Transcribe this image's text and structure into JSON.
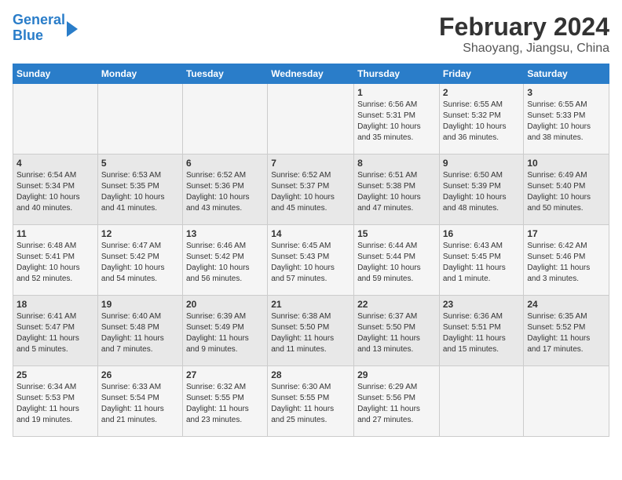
{
  "logo": {
    "line1": "General",
    "line2": "Blue"
  },
  "title": "February 2024",
  "subtitle": "Shaoyang, Jiangsu, China",
  "weekdays": [
    "Sunday",
    "Monday",
    "Tuesday",
    "Wednesday",
    "Thursday",
    "Friday",
    "Saturday"
  ],
  "weeks": [
    [
      {
        "day": "",
        "info": ""
      },
      {
        "day": "",
        "info": ""
      },
      {
        "day": "",
        "info": ""
      },
      {
        "day": "",
        "info": ""
      },
      {
        "day": "1",
        "info": "Sunrise: 6:56 AM\nSunset: 5:31 PM\nDaylight: 10 hours\nand 35 minutes."
      },
      {
        "day": "2",
        "info": "Sunrise: 6:55 AM\nSunset: 5:32 PM\nDaylight: 10 hours\nand 36 minutes."
      },
      {
        "day": "3",
        "info": "Sunrise: 6:55 AM\nSunset: 5:33 PM\nDaylight: 10 hours\nand 38 minutes."
      }
    ],
    [
      {
        "day": "4",
        "info": "Sunrise: 6:54 AM\nSunset: 5:34 PM\nDaylight: 10 hours\nand 40 minutes."
      },
      {
        "day": "5",
        "info": "Sunrise: 6:53 AM\nSunset: 5:35 PM\nDaylight: 10 hours\nand 41 minutes."
      },
      {
        "day": "6",
        "info": "Sunrise: 6:52 AM\nSunset: 5:36 PM\nDaylight: 10 hours\nand 43 minutes."
      },
      {
        "day": "7",
        "info": "Sunrise: 6:52 AM\nSunset: 5:37 PM\nDaylight: 10 hours\nand 45 minutes."
      },
      {
        "day": "8",
        "info": "Sunrise: 6:51 AM\nSunset: 5:38 PM\nDaylight: 10 hours\nand 47 minutes."
      },
      {
        "day": "9",
        "info": "Sunrise: 6:50 AM\nSunset: 5:39 PM\nDaylight: 10 hours\nand 48 minutes."
      },
      {
        "day": "10",
        "info": "Sunrise: 6:49 AM\nSunset: 5:40 PM\nDaylight: 10 hours\nand 50 minutes."
      }
    ],
    [
      {
        "day": "11",
        "info": "Sunrise: 6:48 AM\nSunset: 5:41 PM\nDaylight: 10 hours\nand 52 minutes."
      },
      {
        "day": "12",
        "info": "Sunrise: 6:47 AM\nSunset: 5:42 PM\nDaylight: 10 hours\nand 54 minutes."
      },
      {
        "day": "13",
        "info": "Sunrise: 6:46 AM\nSunset: 5:42 PM\nDaylight: 10 hours\nand 56 minutes."
      },
      {
        "day": "14",
        "info": "Sunrise: 6:45 AM\nSunset: 5:43 PM\nDaylight: 10 hours\nand 57 minutes."
      },
      {
        "day": "15",
        "info": "Sunrise: 6:44 AM\nSunset: 5:44 PM\nDaylight: 10 hours\nand 59 minutes."
      },
      {
        "day": "16",
        "info": "Sunrise: 6:43 AM\nSunset: 5:45 PM\nDaylight: 11 hours\nand 1 minute."
      },
      {
        "day": "17",
        "info": "Sunrise: 6:42 AM\nSunset: 5:46 PM\nDaylight: 11 hours\nand 3 minutes."
      }
    ],
    [
      {
        "day": "18",
        "info": "Sunrise: 6:41 AM\nSunset: 5:47 PM\nDaylight: 11 hours\nand 5 minutes."
      },
      {
        "day": "19",
        "info": "Sunrise: 6:40 AM\nSunset: 5:48 PM\nDaylight: 11 hours\nand 7 minutes."
      },
      {
        "day": "20",
        "info": "Sunrise: 6:39 AM\nSunset: 5:49 PM\nDaylight: 11 hours\nand 9 minutes."
      },
      {
        "day": "21",
        "info": "Sunrise: 6:38 AM\nSunset: 5:50 PM\nDaylight: 11 hours\nand 11 minutes."
      },
      {
        "day": "22",
        "info": "Sunrise: 6:37 AM\nSunset: 5:50 PM\nDaylight: 11 hours\nand 13 minutes."
      },
      {
        "day": "23",
        "info": "Sunrise: 6:36 AM\nSunset: 5:51 PM\nDaylight: 11 hours\nand 15 minutes."
      },
      {
        "day": "24",
        "info": "Sunrise: 6:35 AM\nSunset: 5:52 PM\nDaylight: 11 hours\nand 17 minutes."
      }
    ],
    [
      {
        "day": "25",
        "info": "Sunrise: 6:34 AM\nSunset: 5:53 PM\nDaylight: 11 hours\nand 19 minutes."
      },
      {
        "day": "26",
        "info": "Sunrise: 6:33 AM\nSunset: 5:54 PM\nDaylight: 11 hours\nand 21 minutes."
      },
      {
        "day": "27",
        "info": "Sunrise: 6:32 AM\nSunset: 5:55 PM\nDaylight: 11 hours\nand 23 minutes."
      },
      {
        "day": "28",
        "info": "Sunrise: 6:30 AM\nSunset: 5:55 PM\nDaylight: 11 hours\nand 25 minutes."
      },
      {
        "day": "29",
        "info": "Sunrise: 6:29 AM\nSunset: 5:56 PM\nDaylight: 11 hours\nand 27 minutes."
      },
      {
        "day": "",
        "info": ""
      },
      {
        "day": "",
        "info": ""
      }
    ]
  ]
}
